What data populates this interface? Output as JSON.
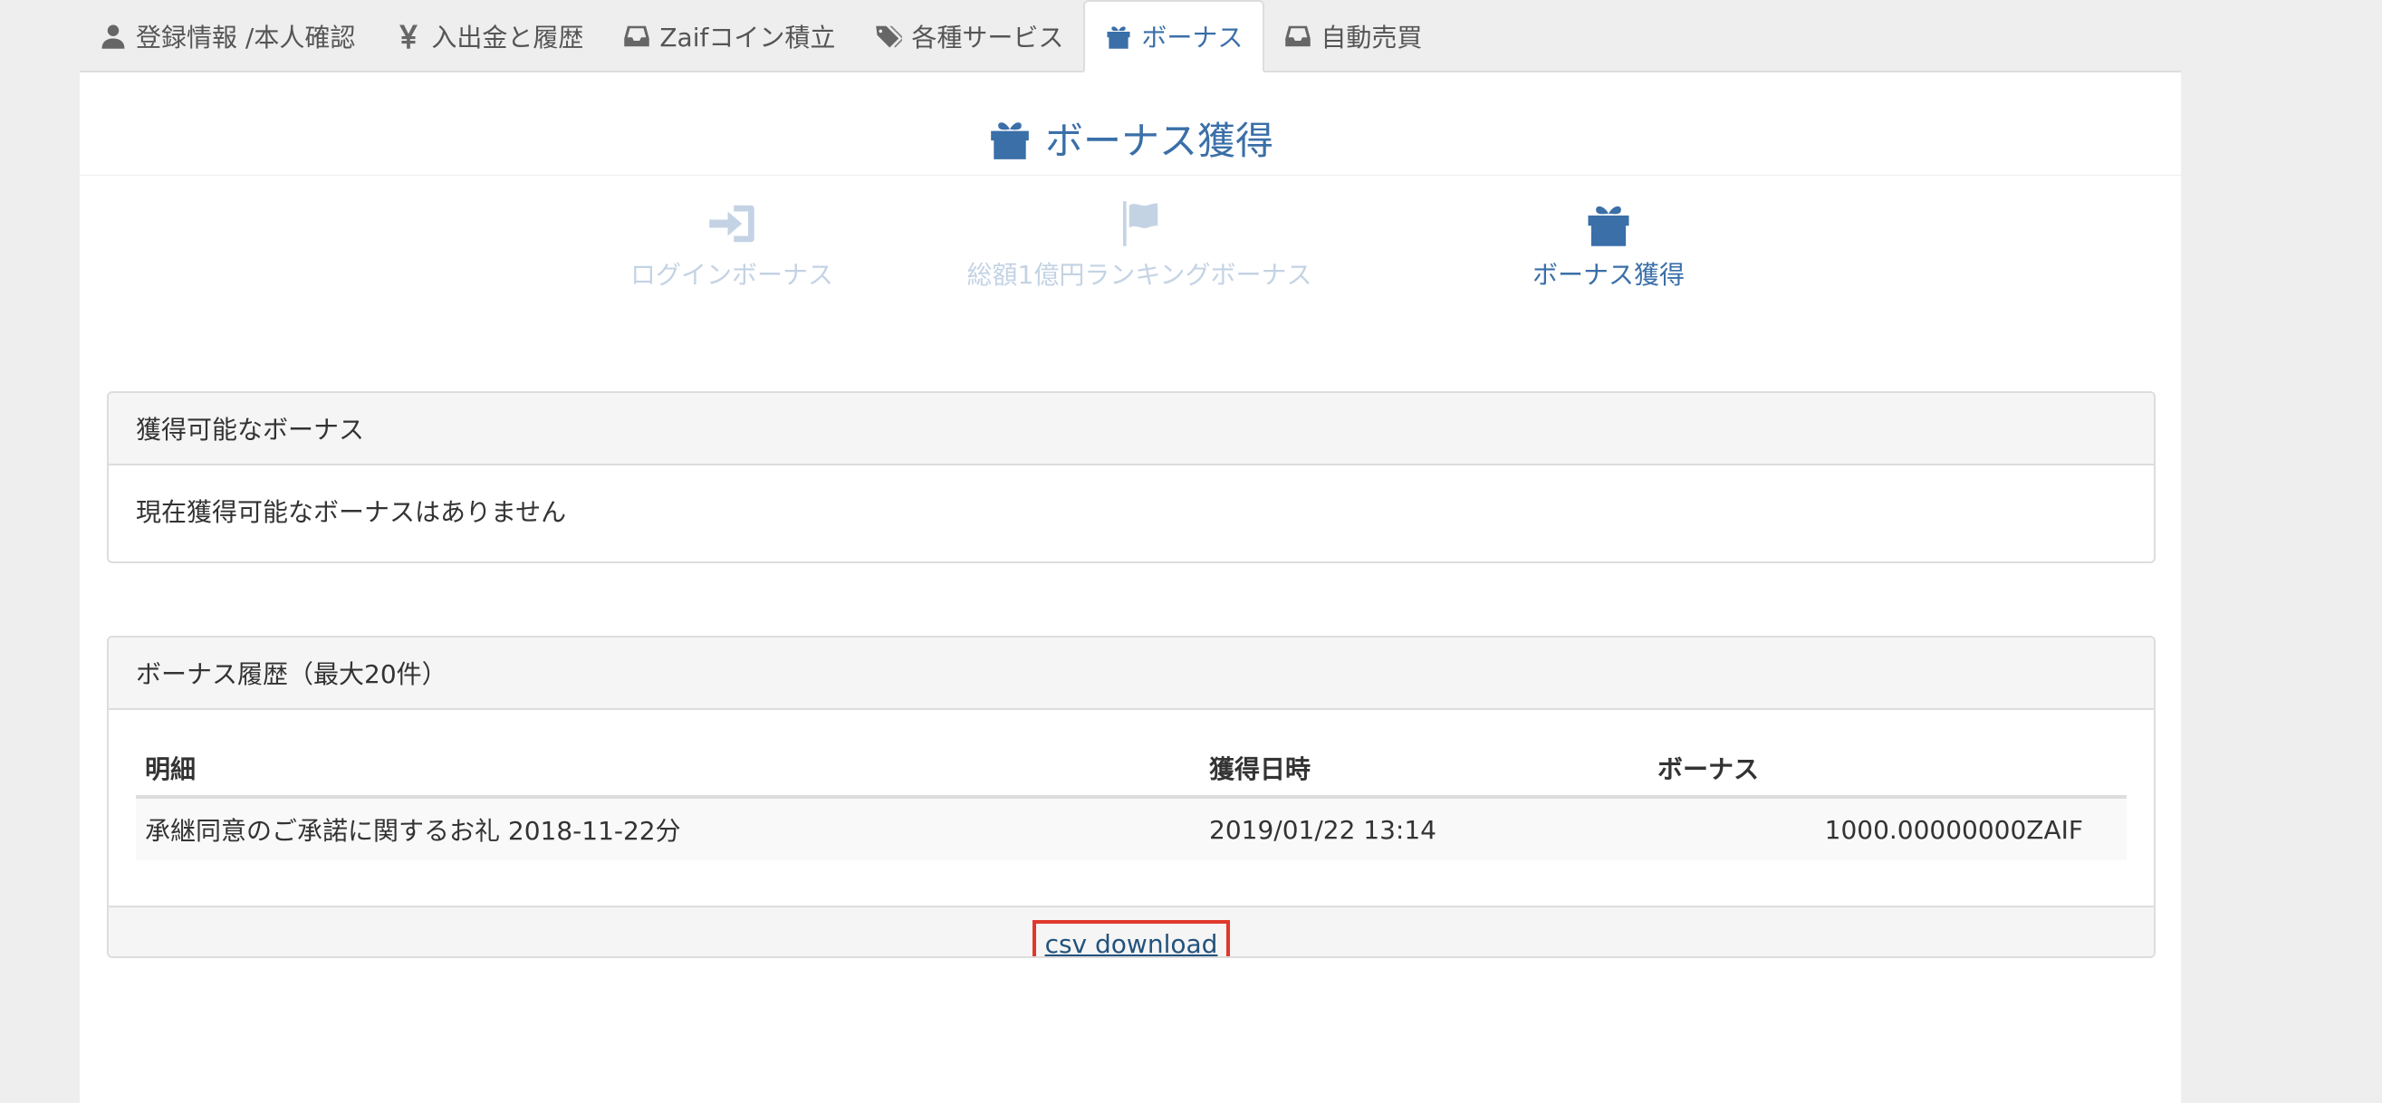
{
  "tabs": [
    {
      "label": "登録情報 /本人確認",
      "icon": "user-icon"
    },
    {
      "label": "入出金と履歴",
      "icon": "yen-icon"
    },
    {
      "label": "Zaifコイン積立",
      "icon": "inbox-icon"
    },
    {
      "label": "各種サービス",
      "icon": "tags-icon"
    },
    {
      "label": "ボーナス",
      "icon": "gift-icon",
      "active": true
    },
    {
      "label": "自動売買",
      "icon": "inbox-icon"
    }
  ],
  "page_title": "ボーナス獲得",
  "subnav": [
    {
      "label": "ログインボーナス",
      "icon": "sign-in-icon",
      "active": false
    },
    {
      "label": "総額1億円ランキングボーナス",
      "icon": "flag-icon",
      "active": false
    },
    {
      "label": "ボーナス獲得",
      "icon": "gift-icon",
      "active": true
    }
  ],
  "available_panel": {
    "heading": "獲得可能なボーナス",
    "message": "現在獲得可能なボーナスはありません"
  },
  "history_panel": {
    "heading": "ボーナス履歴（最大20件）",
    "columns": [
      "明細",
      "獲得日時",
      "ボーナス"
    ],
    "rows": [
      {
        "detail": "承継同意のご承諾に関するお礼 2018-11-22分",
        "date": "2019/01/22 13:14",
        "bonus": "1000.00000000ZAIF"
      }
    ],
    "csv_label": "csv download"
  },
  "colors": {
    "accent": "#3a6fa8",
    "subnav_inactive": "#c4d3e4",
    "highlight_box": "#e0392b",
    "background": "#eeeeee"
  }
}
